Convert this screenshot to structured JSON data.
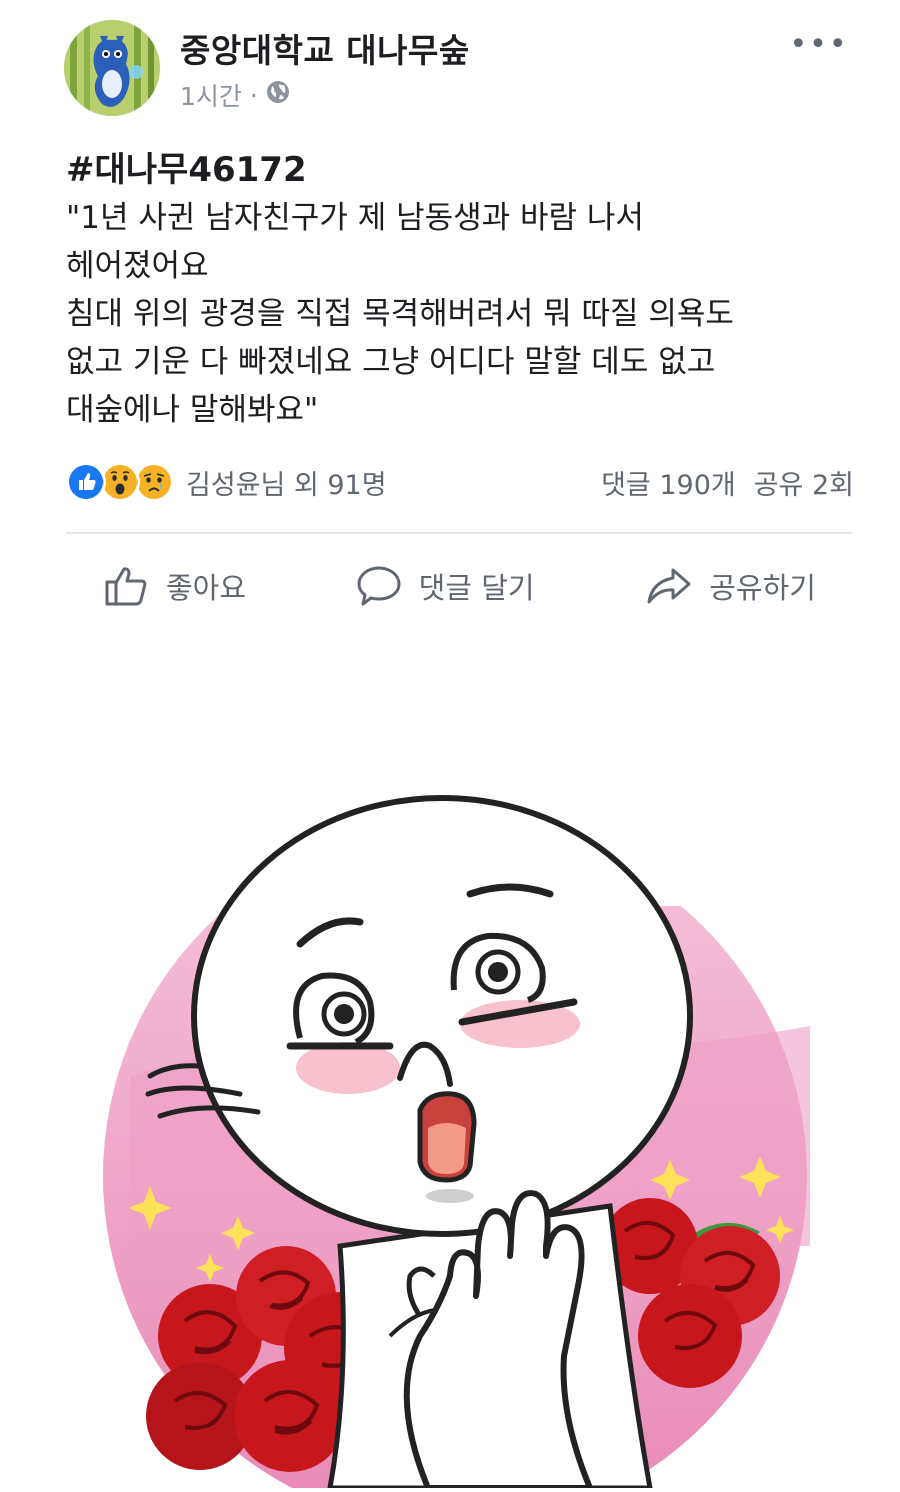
{
  "post": {
    "page_name": "중앙대학교 대나무숲",
    "time": "1시간",
    "separator": "·",
    "more_icon": "more-horizontal-icon",
    "privacy_icon": "globe-icon",
    "hashtag": "#대나무46172",
    "body_lines": [
      "\"1년 사귄 남자친구가 제 남동생과 바람 나서",
      "헤어졌어요",
      "침대 위의 광경을 직접 목격해버려서 뭐 따질 의욕도",
      "없고 기운 다 빠졌네요 그냥 어디다 말할 데도 없고",
      "대숲에나 말해봐요\""
    ]
  },
  "reactions": {
    "icons": [
      "like-reaction-icon",
      "wow-reaction-icon",
      "sad-reaction-icon"
    ],
    "summary": "김성윤님 외 91명",
    "comments": "댓글 190개",
    "shares": "공유 2회"
  },
  "actions": {
    "like": "좋아요",
    "comment": "댓글 달기",
    "share": "공유하기"
  },
  "colors": {
    "text": "#1c1e21",
    "secondary": "#606770",
    "like_blue": "#1877f2",
    "reaction_yellow": "#f7b125",
    "sticker_pink": "#f2a6c6",
    "rose_red": "#c8161d"
  }
}
